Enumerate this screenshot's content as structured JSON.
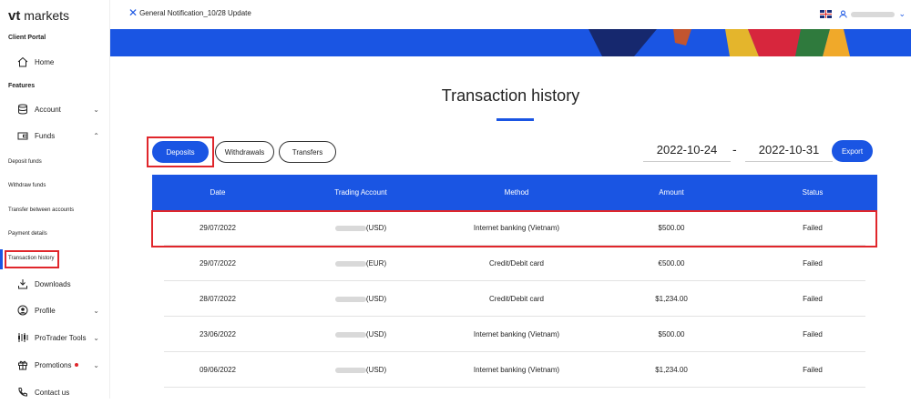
{
  "sidebar": {
    "logo_bold": "vt",
    "logo_rest": "markets",
    "section_portal": "Client Portal",
    "home": "Home",
    "section_features": "Features",
    "account": "Account",
    "funds": "Funds",
    "subs": [
      "Deposit funds",
      "Withdraw funds",
      "Transfer between accounts",
      "Payment details",
      "Transaction history"
    ],
    "downloads": "Downloads",
    "profile": "Profile",
    "protrader": "ProTrader Tools",
    "promotions": "Promotions",
    "contact": "Contact us"
  },
  "topbar": {
    "notification": "General Notification_10/28 Update"
  },
  "page": {
    "title": "Transaction history"
  },
  "tabs": [
    "Deposits",
    "Withdrawals",
    "Transfers"
  ],
  "dates": {
    "from": "2022-10-24",
    "separator": "-",
    "to": "2022-10-31"
  },
  "export_label": "Export",
  "table": {
    "headers": [
      "Date",
      "Trading Account",
      "Method",
      "Amount",
      "Status"
    ],
    "rows": [
      {
        "date": "29/07/2022",
        "currency": "(USD)",
        "method": "Internet banking (Vietnam)",
        "amount": "$500.00",
        "status": "Failed"
      },
      {
        "date": "29/07/2022",
        "currency": "(EUR)",
        "method": "Credit/Debit card",
        "amount": "€500.00",
        "status": "Failed"
      },
      {
        "date": "28/07/2022",
        "currency": "(USD)",
        "method": "Credit/Debit card",
        "amount": "$1,234.00",
        "status": "Failed"
      },
      {
        "date": "23/06/2022",
        "currency": "(USD)",
        "method": "Internet banking (Vietnam)",
        "amount": "$500.00",
        "status": "Failed"
      },
      {
        "date": "09/06/2022",
        "currency": "(USD)",
        "method": "Internet banking (Vietnam)",
        "amount": "$1,234.00",
        "status": "Failed"
      }
    ]
  },
  "colors": {
    "accent": "#1a55e3",
    "highlight": "#e0262b"
  }
}
